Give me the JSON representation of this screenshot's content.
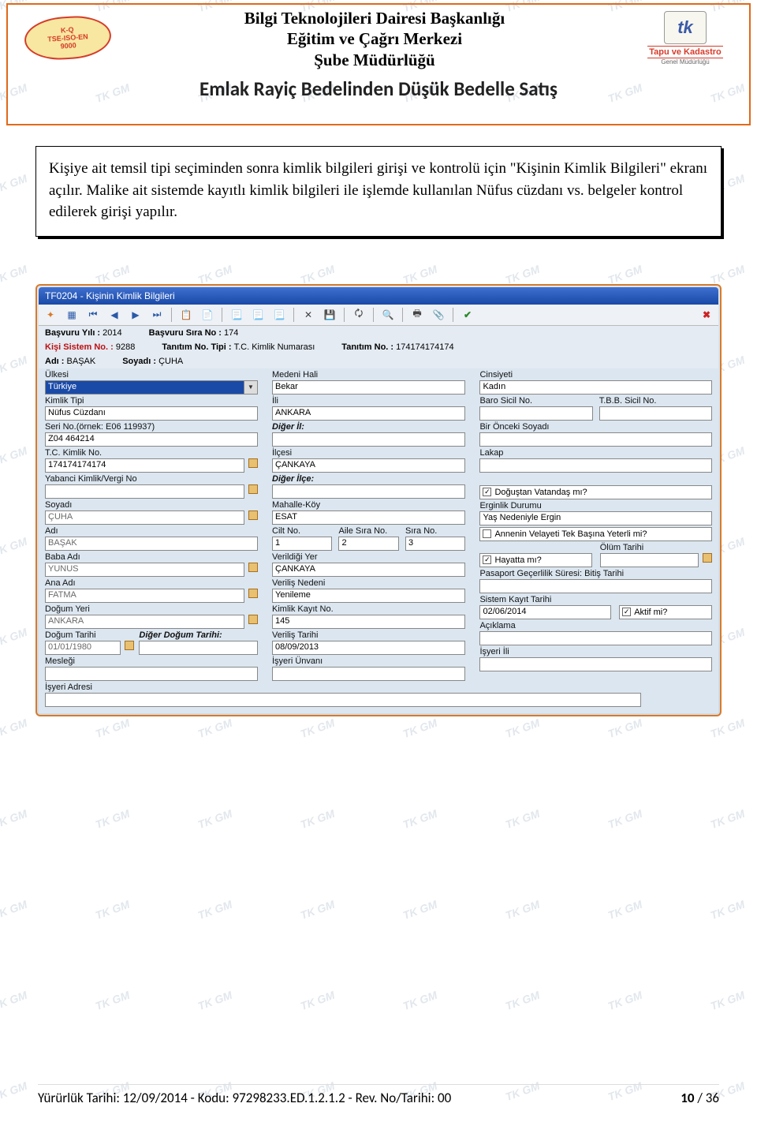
{
  "header": {
    "line1": "Bilgi Teknolojileri Dairesi Başkanlığı",
    "line2": "Eğitim ve Çağrı Merkezi",
    "line3": "Şube Müdürlüğü",
    "subtitle": "Emlak Rayiç Bedelinden Düşük Bedelle Satış",
    "iso_top": "K-Q",
    "iso_mid": "TSE-ISO-EN",
    "iso_bot": "9000",
    "tk": "tk",
    "tk_text": "Tapu ve Kadastro",
    "tk_sub": "Genel Müdürlüğü"
  },
  "note": "Kişiye ait temsil tipi seçiminden sonra kimlik bilgileri girişi ve kontrolü için \"Kişinin Kimlik Bilgileri\" ekranı açılır. Malike ait sistemde kayıtlı kimlik bilgileri ile işlemde kullanılan Nüfus cüzdanı vs. belgeler kontrol edilerek girişi yapılır.",
  "win": {
    "title": "TF0204 - Kişinin Kimlik Bilgileri",
    "info": {
      "yil_l": "Başvuru Yılı :",
      "yil": "2014",
      "sira_l": "Başvuru Sıra No :",
      "sira": "174",
      "sys_l": "Kişi Sistem No. :",
      "sys": "9288",
      "tip_l": "Tanıtım No. Tipi :",
      "tip": "T.C. Kimlik Numarası",
      "tno_l": "Tanıtım No. :",
      "tno": "174174174174",
      "adi_l": "Adı :",
      "adi": "BAŞAK",
      "soy_l": "Soyadı :",
      "soy": "ÇUHA"
    },
    "c1": {
      "ulke_l": "Ülkesi",
      "ulke": "Türkiye",
      "kt_l": "Kimlik Tipi",
      "kt": "Nüfus Cüzdanı",
      "seri_l": "Seri No.(örnek: E06 119937)",
      "seri": "Z04 464214",
      "tc_l": "T.C. Kimlik No.",
      "tc": "174174174174",
      "yab_l": "Yabanci Kimlik/Vergi No",
      "yab": "",
      "soyadi_l": "Soyadı",
      "soyadi": "ÇUHA",
      "adi_l": "Adı",
      "adi": "BAŞAK",
      "baba_l": "Baba Adı",
      "baba": "YUNUS",
      "ana_l": "Ana Adı",
      "ana": "FATMA",
      "dyer_l": "Doğum Yeri",
      "dyer": "ANKARA",
      "dtar_l": "Doğum Tarihi",
      "dtar": "01/01/1980",
      "ddt_l": "Diğer Doğum Tarihi:",
      "mes_l": "Mesleği",
      "mes": "",
      "iadr_l": "İşyeri Adresi",
      "iadr": ""
    },
    "c2": {
      "med_l": "Medeni Hali",
      "med": "Bekar",
      "il_l": "İli",
      "il": "ANKARA",
      "dil_l": "Diğer İl:",
      "ilce_l": "İlçesi",
      "ilce": "ÇANKAYA",
      "dilce_l": "Diğer İlçe:",
      "mah_l": "Mahalle-Köy",
      "mah": "ESAT",
      "cilt_l": "Cilt No.",
      "cilt": "1",
      "aile_l": "Aile Sıra No.",
      "aile": "2",
      "sira_l": "Sıra No.",
      "sira": "3",
      "vyer_l": "Verildiği Yer",
      "vyer": "ÇANKAYA",
      "vned_l": "Veriliş Nedeni",
      "vned": "Yenileme",
      "kkay_l": "Kimlik Kayıt No.",
      "kkay": "145",
      "vtar_l": "Veriliş Tarihi",
      "vtar": "08/09/2013",
      "iunv_l": "İşyeri Ünvanı",
      "iunv": ""
    },
    "c3": {
      "cins_l": "Cinsiyeti",
      "cins": "Kadın",
      "baro_l": "Baro Sicil No.",
      "tbb_l": "T.B.B. Sicil No.",
      "bonc_l": "Bir Önceki Soyadı",
      "lakap_l": "Lakap",
      "dog_l": "Doğuştan Vatandaş mı?",
      "erg_l": "Erginlik Durumu",
      "erg": "Yaş Nedeniyle Ergin",
      "vel_l": "Annenin Velayeti Tek Başına Yeterli mi?",
      "olum_l": "Ölüm Tarihi",
      "hay_l": "Hayatta mı?",
      "pas_l": "Pasaport Geçerlilik Süresi: Bitiş Tarihi",
      "skt_l": "Sistem Kayıt Tarihi",
      "skt": "02/06/2014",
      "akt_l": "Aktif mi?",
      "acik_l": "Açıklama",
      "iil_l": "İşyeri İli"
    }
  },
  "footer": {
    "left": "Yürürlük Tarihi:  12/09/2014  -  Kodu:  97298233.ED.1.2.1.2  -  Rev. No/Tarihi: 00",
    "pg_cur": "10",
    "pg_sep": " / ",
    "pg_tot": "36"
  },
  "wm": "TK GM"
}
